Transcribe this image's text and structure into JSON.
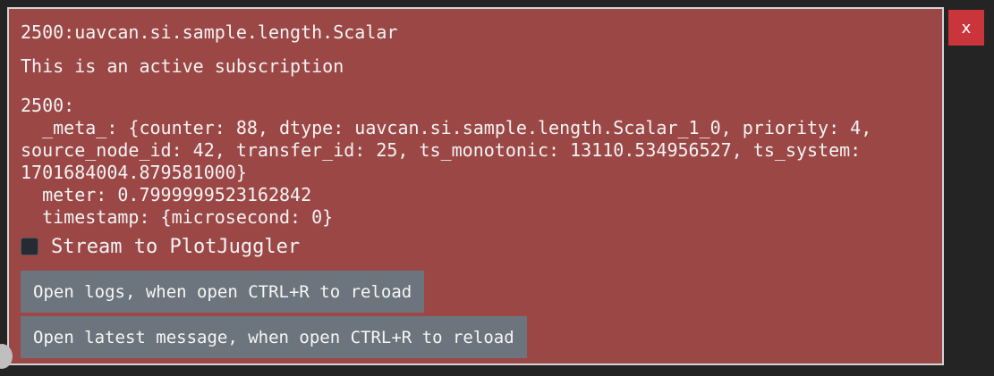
{
  "window": {
    "title": "2500:uavcan.si.sample.length.Scalar",
    "status": "This is an active subscription",
    "close_label": "x"
  },
  "message": {
    "text": "2500:\n  _meta_: {counter: 88, dtype: uavcan.si.sample.length.Scalar_1_0, priority: 4, source_node_id: 42, transfer_id: 25, ts_monotonic: 13110.534956527, ts_system: 1701684004.879581000}\n  meter: 0.7999999523162842\n  timestamp: {microsecond: 0}"
  },
  "stream": {
    "label": "Stream to PlotJuggler",
    "checked": false
  },
  "buttons": {
    "open_logs": "Open logs, when open CTRL+R to reload",
    "open_latest": "Open latest message, when open CTRL+R to reload"
  },
  "colors": {
    "panel_bg": "#9b4746",
    "button_bg": "#6c757d",
    "close_bg": "#c9353b",
    "page_bg": "#242424"
  }
}
